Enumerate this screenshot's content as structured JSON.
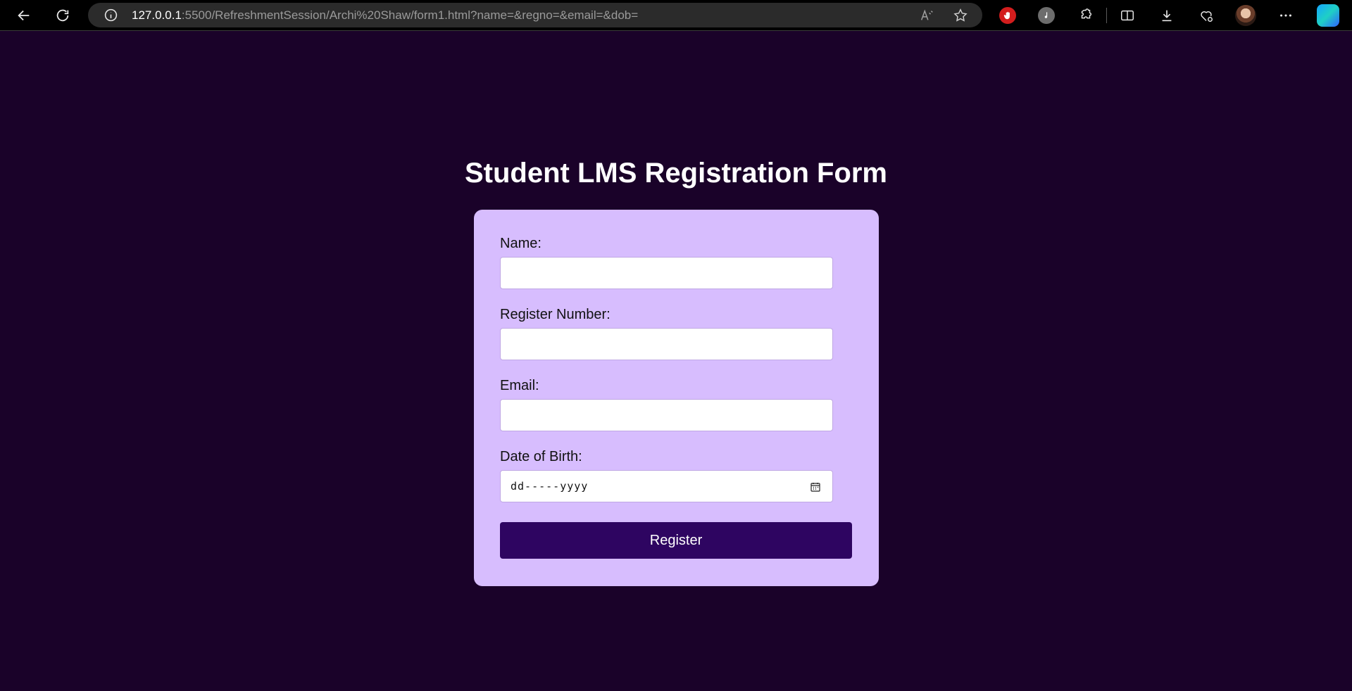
{
  "browser": {
    "url_host": "127.0.0.1",
    "url_rest": ":5500/RefreshmentSession/Archi%20Shaw/form1.html?name=&regno=&email=&dob="
  },
  "page": {
    "title": "Student LMS Registration Form"
  },
  "form": {
    "fields": [
      {
        "label": "Name:",
        "value": ""
      },
      {
        "label": "Register Number:",
        "value": ""
      },
      {
        "label": "Email:",
        "value": ""
      },
      {
        "label": "Date of Birth:",
        "value": "",
        "placeholder": "dd-----yyyy"
      }
    ],
    "submit_label": "Register"
  },
  "colors": {
    "page_background": "#1a0229",
    "card_background": "#d7bdfe",
    "button_background": "#2e0561"
  }
}
